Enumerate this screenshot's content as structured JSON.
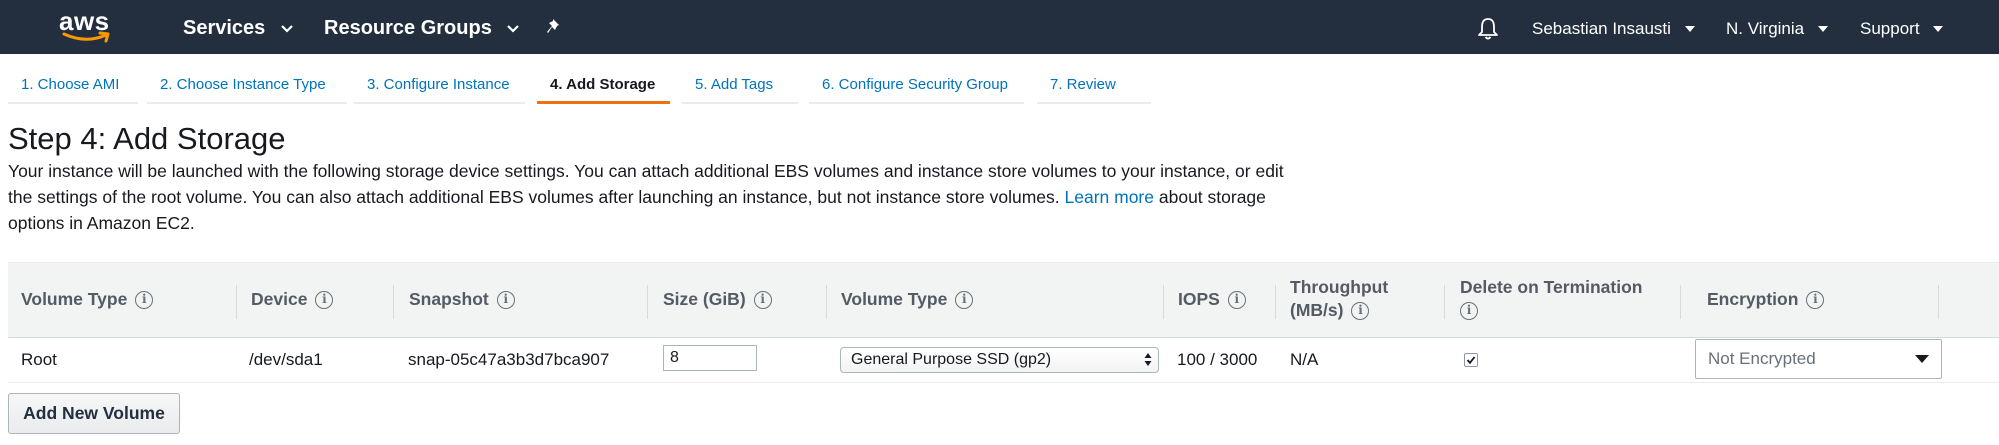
{
  "nav": {
    "logo": "aws",
    "services": "Services",
    "resource_groups": "Resource Groups",
    "pin_icon": "pin-icon",
    "bell_icon": "bell-icon",
    "user": "Sebastian Insausti",
    "region": "N. Virginia",
    "support": "Support"
  },
  "wizard_tabs": [
    {
      "label": "1. Choose AMI",
      "active": false
    },
    {
      "label": "2. Choose Instance Type",
      "active": false
    },
    {
      "label": "3. Configure Instance",
      "active": false
    },
    {
      "label": "4. Add Storage",
      "active": true
    },
    {
      "label": "5. Add Tags",
      "active": false
    },
    {
      "label": "6. Configure Security Group",
      "active": false
    },
    {
      "label": "7. Review",
      "active": false
    }
  ],
  "page": {
    "title": "Step 4: Add Storage",
    "desc_part1": "Your instance will be launched with the following storage device settings. You can attach additional EBS volumes and instance store volumes to your instance, or edit the settings of the root volume. You can also attach additional EBS volumes after launching an instance, but not instance store volumes.",
    "learn_more": "Learn more",
    "desc_part2": "about storage options in Amazon EC2."
  },
  "table": {
    "headers": {
      "volume_type": "Volume Type",
      "device": "Device",
      "snapshot": "Snapshot",
      "size": "Size (GiB)",
      "volume_type2": "Volume Type",
      "iops": "IOPS",
      "throughput_line1": "Throughput",
      "throughput_line2": "(MB/s)",
      "delete_line1": "Delete on Termination",
      "encryption": "Encryption"
    },
    "info_glyph": "i",
    "row": {
      "volume_type": "Root",
      "device": "/dev/sda1",
      "snapshot": "snap-05c47a3b3d7bca907",
      "size": "8",
      "ebs_type": "General Purpose SSD (gp2)",
      "iops": "100 / 3000",
      "throughput": "N/A",
      "delete_on_termination": true,
      "encryption": "Not Encrypted"
    }
  },
  "buttons": {
    "add_new_volume": "Add New Volume"
  },
  "colors": {
    "nav_bg": "#232f3e",
    "link": "#0073bb",
    "accent": "#ec7211"
  }
}
